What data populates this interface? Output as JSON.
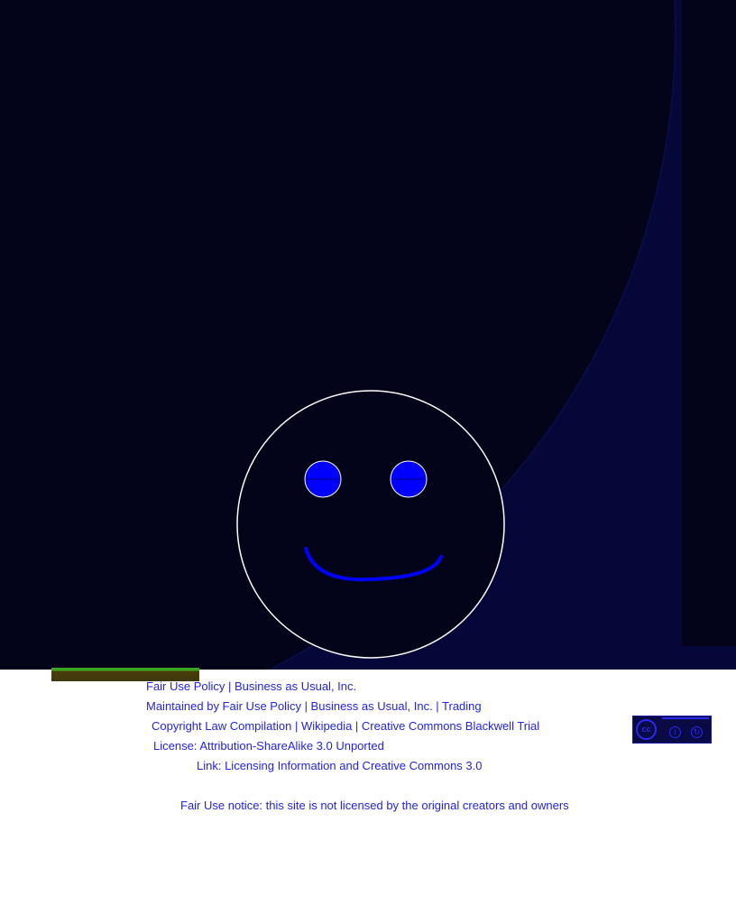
{
  "credits": {
    "line1": "Fair Use Policy | Business as Usual, Inc.",
    "line2": "Maintained by Fair Use Policy | Business as Usual, Inc. | Trading",
    "line3": "Copyright Law Compilation | Wikipedia | Creative Commons Blackwell Trial",
    "line4": "License: Attribution-ShareAlike 3.0 Unported",
    "line5": "Link: Licensing Information and Creative Commons 3.0",
    "line6": "Fair Use notice: this site is not licensed by the original creators and owners"
  },
  "badge": {
    "cc_label": "cc",
    "by_label": "i",
    "sa_label": "↻"
  },
  "colors": {
    "background": "#03031a",
    "face_outline": "#ffffff",
    "features": "#0000ff",
    "text": "#2323e0"
  }
}
